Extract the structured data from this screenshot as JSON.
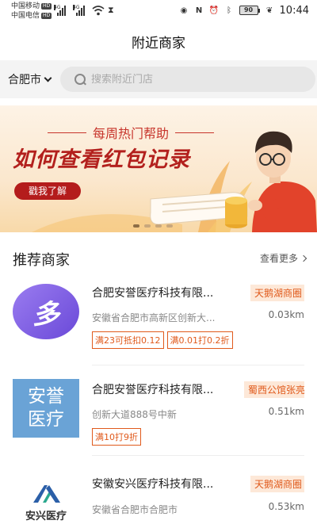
{
  "status_bar": {
    "carrier1": "中国移动",
    "carrier2": "中国电信",
    "hd": "HD",
    "net1": "4G",
    "net2": "4G",
    "battery": "90",
    "time": "10:44"
  },
  "header": {
    "title": "附近商家"
  },
  "location": {
    "city": "合肥市"
  },
  "search": {
    "placeholder": "搜索附近门店"
  },
  "banner": {
    "subtitle": "每周热门帮助",
    "title": "如何查看红包记录",
    "button": "戳我了解",
    "dots": 4
  },
  "section": {
    "title": "推荐商家",
    "see_more": "查看更多"
  },
  "merchants": [
    {
      "name": "合肥安誉医疗科技有限...",
      "tag": "天鹅湖商圈",
      "address": "安徽省合肥市高新区创新大...",
      "distance": "0.03km",
      "coupons": [
        "满23可抵扣0.12",
        "满0.01打0.2折"
      ],
      "logo_text": "多"
    },
    {
      "name": "合肥安誉医疗科技有限...",
      "tag": "蜀西公馆张亮...",
      "address": "创新大道888号中新",
      "distance": "0.51km",
      "coupons": [
        "满10打9折"
      ],
      "logo_text_1": "安誉",
      "logo_text_2": "医疗"
    },
    {
      "name": "安徽安兴医疗科技有限...",
      "tag": "天鹅湖商圈",
      "address": "安徽省合肥市合肥市",
      "distance": "0.53km",
      "coupons": [],
      "logo_text": "安兴医疗"
    }
  ],
  "colors": {
    "accent": "#e05a1c",
    "banner_red": "#b3201d",
    "logo_purple": "#7b5ae0",
    "logo_blue": "#6aa3d6"
  }
}
